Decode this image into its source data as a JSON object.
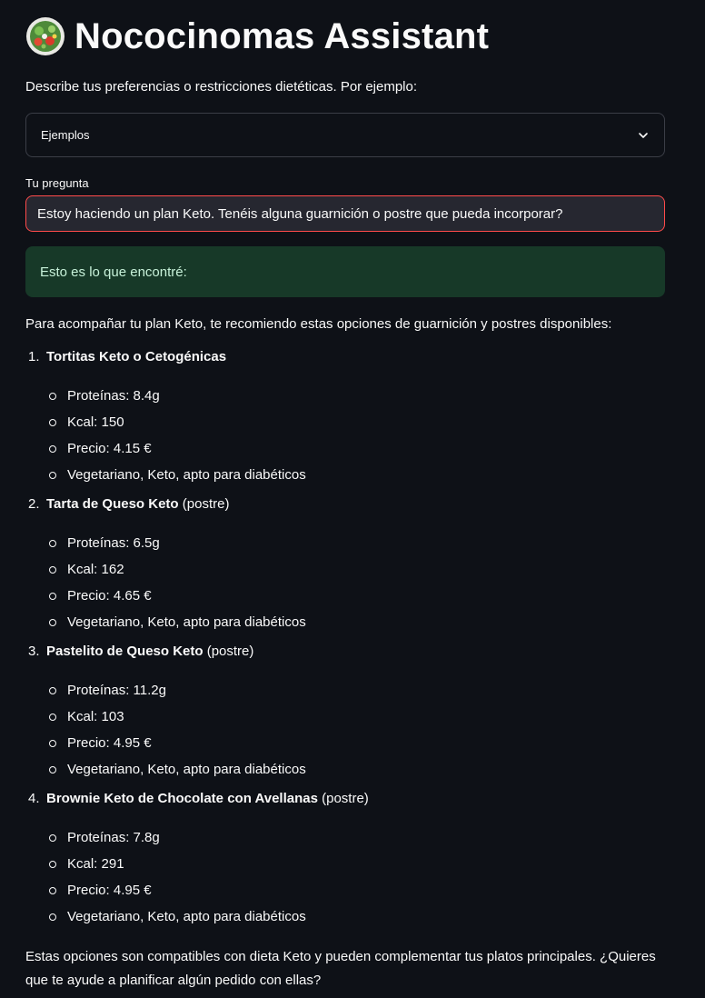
{
  "header": {
    "title": "Nococinomas Assistant",
    "logo_icon": "salad-bowl-icon"
  },
  "description": "Describe tus preferencias o restricciones dietéticas. Por ejemplo:",
  "examples_select": {
    "selected": "Ejemplos",
    "icon": "chevron-down-icon"
  },
  "question": {
    "label": "Tu pregunta",
    "value": "Estoy haciendo un plan Keto. Tenéis alguna guarnición o postre que pueda incorporar?"
  },
  "success_message": "Esto es lo que encontré:",
  "response": {
    "intro": "Para acompañar tu plan Keto, te recomiendo estas opciones de guarnición y postres disponibles:",
    "items": [
      {
        "number": "1.",
        "name": "Tortitas Keto o Cetogénicas",
        "suffix": "",
        "details": [
          "Proteínas: 8.4g",
          "Kcal: 150",
          "Precio: 4.15 €",
          "Vegetariano, Keto, apto para diabéticos"
        ]
      },
      {
        "number": "2.",
        "name": "Tarta de Queso Keto",
        "suffix": " (postre)",
        "details": [
          "Proteínas: 6.5g",
          "Kcal: 162",
          "Precio: 4.65 €",
          "Vegetariano, Keto, apto para diabéticos"
        ]
      },
      {
        "number": "3.",
        "name": "Pastelito de Queso Keto",
        "suffix": " (postre)",
        "details": [
          "Proteínas: 11.2g",
          "Kcal: 103",
          "Precio: 4.95 €",
          "Vegetariano, Keto, apto para diabéticos"
        ]
      },
      {
        "number": "4.",
        "name": "Brownie Keto de Chocolate con Avellanas",
        "suffix": " (postre)",
        "details": [
          "Proteínas: 7.8g",
          "Kcal: 291",
          "Precio: 4.95 €",
          "Vegetariano, Keto, apto para diabéticos"
        ]
      }
    ],
    "outro": "Estas opciones son compatibles con dieta Keto y pueden complementar tus platos principales. ¿Quieres que te ayude a planificar algún pedido con ellas?"
  },
  "colors": {
    "background": "#0e1117",
    "input_background": "#262730",
    "input_border_focus": "#ff4b4b",
    "success_background": "#173928",
    "success_text": "#c7f1d9",
    "text": "#fafafa"
  }
}
